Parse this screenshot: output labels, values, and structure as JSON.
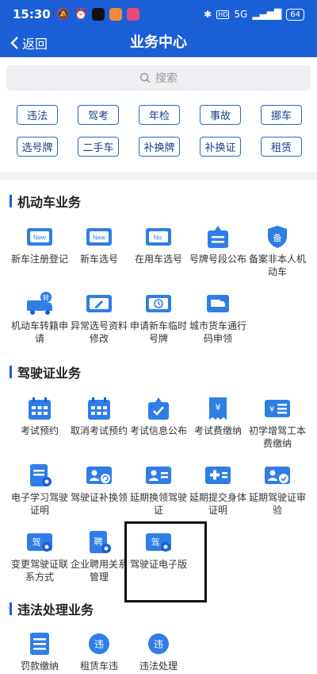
{
  "status_bar": {
    "time": "15:30",
    "network": "5G",
    "battery": "64",
    "hd": "HD"
  },
  "nav": {
    "back_label": "返回",
    "title": "业务中心"
  },
  "search": {
    "placeholder": "搜索"
  },
  "quick_tags": [
    "违法",
    "驾考",
    "年检",
    "事故",
    "挪车",
    "选号牌",
    "二手车",
    "补换牌",
    "补换证",
    "租赁"
  ],
  "sections": [
    {
      "title": "机动车业务",
      "items": [
        {
          "label": "新车注册登记",
          "icon": "new-car-card-icon"
        },
        {
          "label": "新车选号",
          "icon": "new-plate-icon"
        },
        {
          "label": "在用车选号",
          "icon": "number-plate-icon"
        },
        {
          "label": "号牌号段公布",
          "icon": "announcement-icon"
        },
        {
          "label": "备案非本人机动车",
          "icon": "record-shield-icon"
        },
        {
          "label": "机动车转籍申请",
          "icon": "transfer-truck-icon"
        },
        {
          "label": "异常选号资料修改",
          "icon": "edit-card-icon"
        },
        {
          "label": "申请新车临时号牌",
          "icon": "temp-plate-icon"
        },
        {
          "label": "城市货车通行码申领",
          "icon": "truck-pass-icon"
        }
      ]
    },
    {
      "title": "驾驶证业务",
      "items": [
        {
          "label": "考试预约",
          "icon": "calendar-icon"
        },
        {
          "label": "取消考试预约",
          "icon": "calendar-cancel-icon"
        },
        {
          "label": "考试信息公布",
          "icon": "exam-info-icon"
        },
        {
          "label": "考试费缴纳",
          "icon": "fee-receipt-icon"
        },
        {
          "label": "初学增驾工本费缴纳",
          "icon": "fee-card-icon"
        },
        {
          "label": "电子学习驾驶证明",
          "icon": "study-doc-icon"
        },
        {
          "label": "驾驶证补换领",
          "icon": "license-reissue-icon"
        },
        {
          "label": "延期换领驾驶证",
          "icon": "license-extend-icon"
        },
        {
          "label": "延期提交身体证明",
          "icon": "medical-card-icon"
        },
        {
          "label": "延期驾驶证审验",
          "icon": "license-verify-icon"
        },
        {
          "label": "变更驾驶证联系方式",
          "icon": "license-contact-icon"
        },
        {
          "label": "企业聘用关系管理",
          "icon": "employment-doc-icon"
        },
        {
          "label": "驾驶证电子版",
          "icon": "e-license-icon"
        }
      ]
    },
    {
      "title": "违法处理业务",
      "items": [
        {
          "label": "罚款缴纳",
          "icon": "fine-payment-icon"
        },
        {
          "label": "租赁车违",
          "icon": "rental-violation-icon"
        },
        {
          "label": "违法处理",
          "icon": "violation-handle-icon"
        }
      ]
    }
  ],
  "colors": {
    "primary": "#1a5fd6",
    "icon_blue": "#2f7ee6",
    "tag_border": "#2b66c8"
  }
}
